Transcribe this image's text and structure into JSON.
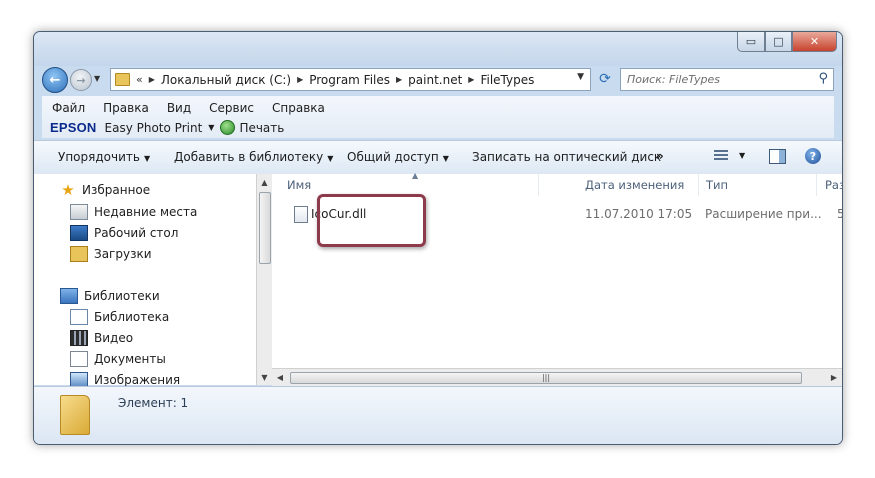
{
  "titlebar": {
    "minimize_glyph": "▭",
    "maximize_glyph": "□",
    "close_glyph": "✕"
  },
  "nav": {
    "back_glyph": "←",
    "forward_glyph": "→"
  },
  "address": {
    "lead_chevrons": "«",
    "crumbs": [
      "Локальный диск (C:)",
      "Program Files",
      "paint.net",
      "FileTypes"
    ]
  },
  "search": {
    "placeholder": "Поиск: FileTypes"
  },
  "menubar": {
    "items": [
      "Файл",
      "Правка",
      "Вид",
      "Сервис",
      "Справка"
    ]
  },
  "epsonbar": {
    "brand": "EPSON",
    "app": "Easy Photo Print",
    "print_label": "Печать"
  },
  "toolbar": {
    "organize": "Упорядочить",
    "add_to_library": "Добавить в библиотеку",
    "share": "Общий доступ",
    "burn": "Записать на оптический диск",
    "more": "»"
  },
  "navpane": {
    "favorites": "Избранное",
    "recent": "Недавние места",
    "desktop": "Рабочий стол",
    "downloads": "Загрузки",
    "libraries": "Библиотеки",
    "library": "Библиотека",
    "video": "Видео",
    "documents": "Документы",
    "images": "Изображения"
  },
  "columns": {
    "name": "Имя",
    "date": "Дата изменения",
    "type": "Тип",
    "size": "Размер"
  },
  "files": [
    {
      "name": "IcoCur.dll",
      "date": "11.07.2010 17:05",
      "type": "Расширение при...",
      "size": "5"
    }
  ],
  "status": {
    "text": "Элемент: 1"
  },
  "colors": {
    "accent": "#2e6fb8",
    "highlight_border": "#8e3a4d",
    "epson_blue": "#0a2b8c"
  }
}
